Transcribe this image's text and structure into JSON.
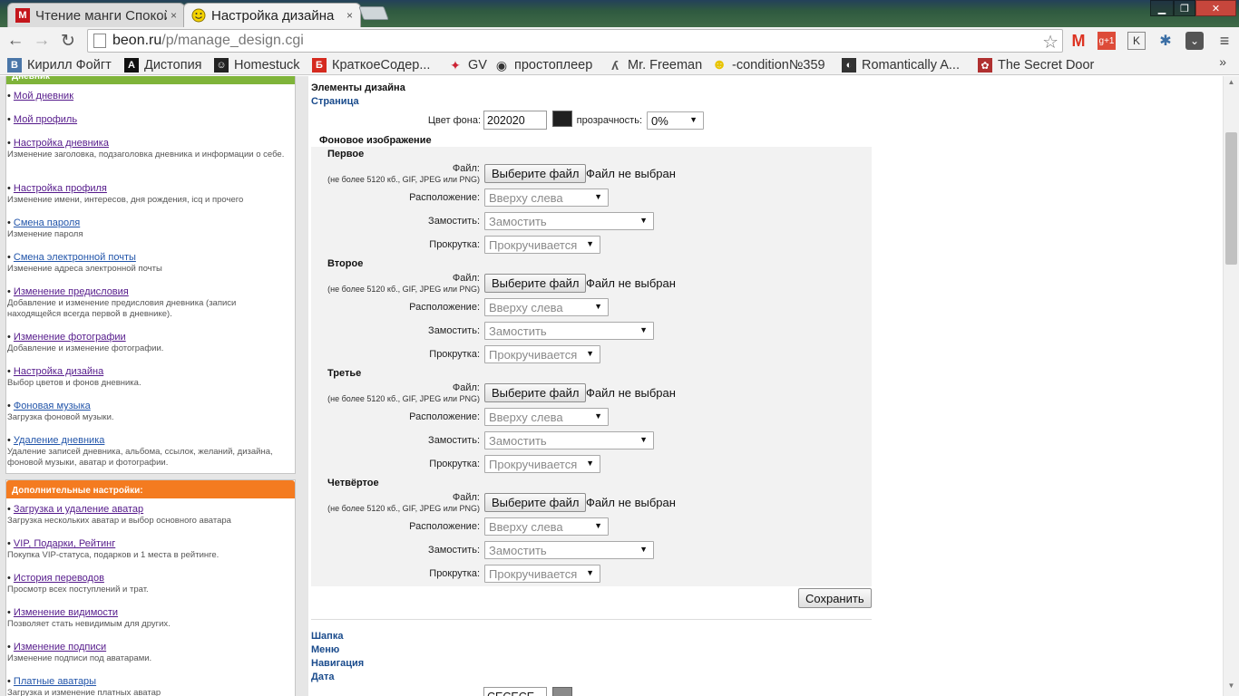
{
  "browser": {
    "tabs": [
      {
        "title": "Чтение манги Спокойной ночи, Пун",
        "active": false
      },
      {
        "title": "Настройка дизайна",
        "active": true
      }
    ],
    "close_glyph": "×",
    "url_host": "beon.ru",
    "url_path": "/p/manage_design.cgi",
    "bookmarks": [
      {
        "label": "Кирилл Фойгт",
        "icon": "В",
        "color": "#4a76a8"
      },
      {
        "label": "Дистопия",
        "icon": "A",
        "color": "#111111"
      },
      {
        "label": "Homestuck",
        "icon": "☺",
        "color": "#222222"
      },
      {
        "label": "КраткоеСодер...",
        "icon": "Б",
        "color": "#d52a1f"
      },
      {
        "label": "GV",
        "icon": "✦",
        "color": "#cc2233"
      },
      {
        "label": "простоплеер",
        "icon": "◉",
        "color": "#333333"
      },
      {
        "label": "Mr. Freeman",
        "icon": "ʎ",
        "color": "#555555"
      },
      {
        "label": "-condition№359",
        "icon": "☻",
        "color": "#e8c400"
      },
      {
        "label": "Romantically A...",
        "icon": "◐",
        "color": "#333333"
      },
      {
        "label": "The Secret Door",
        "icon": "✿",
        "color": "#b03030"
      }
    ],
    "bookmarks_more": "»"
  },
  "sidebar": {
    "box1_title": "Дневник",
    "box1_items": [
      {
        "link": "Мой дневник",
        "desc": ""
      },
      {
        "link": "Мой профиль",
        "desc": ""
      },
      {
        "link": "Настройка дневника",
        "desc": "Изменение заголовка, подзаголовка дневника и информации о себе."
      },
      {
        "link": "Настройка профиля",
        "desc": "Изменение имени, интересов, дня рождения, icq и прочего"
      },
      {
        "link": "Смена пароля",
        "desc": "Изменение пароля"
      },
      {
        "link": "Смена электронной почты",
        "desc": "Изменение адреса электронной почты"
      },
      {
        "link": "Изменение предисловия",
        "desc": "Добавление и изменение предисловия дневника (записи находящейся всегда первой в дневнике)."
      },
      {
        "link": "Изменение фотографии",
        "desc": "Добавление и изменение фотографии."
      },
      {
        "link": "Настройка дизайна",
        "desc": "Выбор цветов и фонов дневника."
      },
      {
        "link": "Фоновая музыка",
        "desc": "Загрузка фоновой музыки."
      },
      {
        "link": "Удаление дневника",
        "desc": "Удаление записей дневника, альбома, ссылок, желаний, дизайна, фоновой музыки, аватар и фотографии."
      }
    ],
    "box2_title": "Дополнительные настройки:",
    "box2_items": [
      {
        "link": "Загрузка и удаление аватар",
        "desc": "Загрузка нескольких аватар и выбор основного аватара"
      },
      {
        "link": "VIP, Подарки, Рейтинг",
        "desc": "Покупка VIP-статуса, подарков и 1 места в рейтинге."
      },
      {
        "link": "История переводов",
        "desc": "Просмотр всех поступлений и трат."
      },
      {
        "link": "Изменение видимости",
        "desc": "Позволяет стать невидимым для других."
      },
      {
        "link": "Изменение подписи",
        "desc": "Изменение подписи под аватарами."
      },
      {
        "link": "Платные аватары",
        "desc": "Загрузка и изменение платных аватар"
      }
    ],
    "bullet": "•",
    "box1_color": "#7fb43a",
    "box2_color": "#f47b20"
  },
  "design": {
    "heading": "Элементы дизайна",
    "section_page": "Страница",
    "bg_color_label": "Цвет фона:",
    "bg_color_value": "202020",
    "bg_color_hex": "#202020",
    "transparency_label": "прозрачность:",
    "transparency_value": "0%",
    "bg_image_title": "Фоновое изображение",
    "images": [
      {
        "title": "Первое"
      },
      {
        "title": "Второе"
      },
      {
        "title": "Третье"
      },
      {
        "title": "Четвёртое"
      }
    ],
    "file_label": "Файл:",
    "file_hint": "(не более 5120 кб., GIF, JPEG или PNG)",
    "file_button": "Выберите файл",
    "no_file": "Файл не выбран",
    "position_label": "Расположение:",
    "position_value": "Вверху слева",
    "tile_label": "Замостить:",
    "tile_value": "Замостить",
    "scroll_label": "Прокрутка:",
    "scroll_value": "Прокручивается",
    "save_button": "Сохранить",
    "sections_after": [
      "Шапка",
      "Меню",
      "Навигация",
      "Дата"
    ],
    "next_color_value": "CECECE",
    "next_color_hex": "#8a8a8a"
  }
}
